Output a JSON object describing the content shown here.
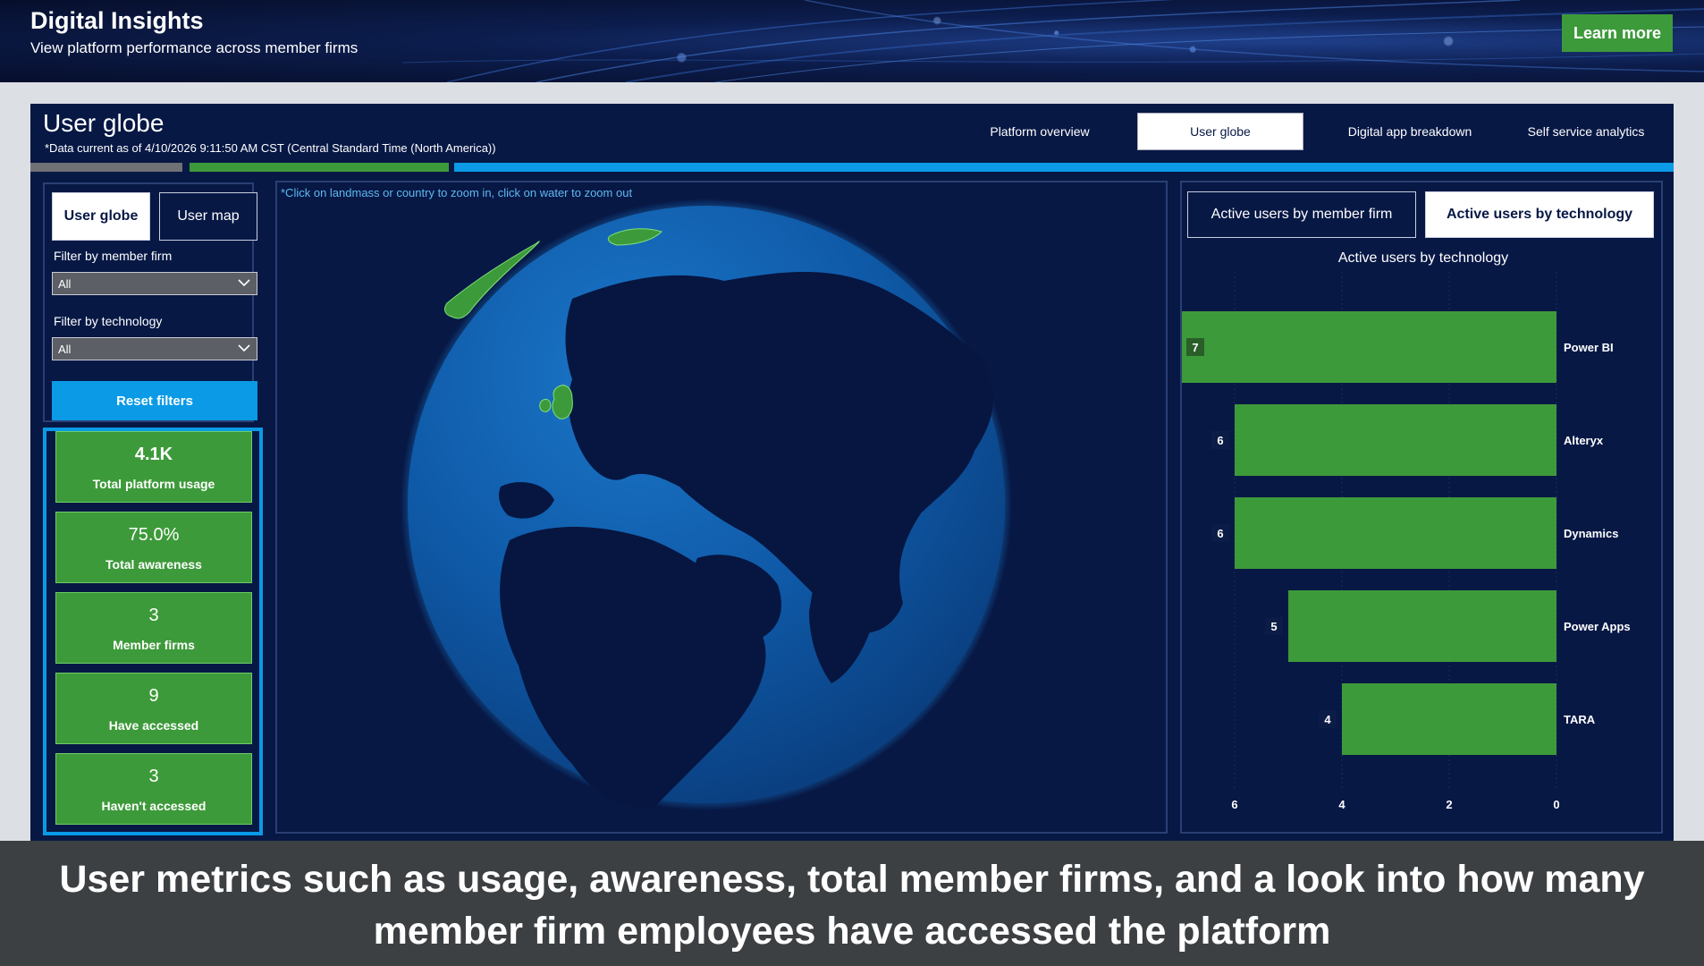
{
  "banner": {
    "title": "Digital Insights",
    "subtitle": "View platform performance across member firms",
    "learn_more": "Learn more"
  },
  "dashboard": {
    "title": "User globe",
    "data_note": "*Data current as of 4/10/2026 9:11:50 AM CST (Central Standard Time (North America))",
    "nav": [
      {
        "label": "Platform overview",
        "active": false
      },
      {
        "label": "User globe",
        "active": true
      },
      {
        "label": "Digital app breakdown",
        "active": false
      },
      {
        "label": "Self service analytics",
        "active": false
      }
    ],
    "colors": {
      "navy": "#071845",
      "green": "#3d9a3a",
      "blue": "#0a9ae6",
      "gray": "#6f7175"
    }
  },
  "left": {
    "tabs": [
      {
        "label": "User globe",
        "active": true
      },
      {
        "label": "User map",
        "active": false
      }
    ],
    "filter_member_label": "Filter by member firm",
    "filter_member_value": "All",
    "filter_tech_label": "Filter by technology",
    "filter_tech_value": "All",
    "reset": "Reset filters",
    "kpis": [
      {
        "value": "4.1K",
        "label": "Total platform usage"
      },
      {
        "value": "75.0%",
        "label": "Total awareness"
      },
      {
        "value": "3",
        "label": "Member firms"
      },
      {
        "value": "9",
        "label": "Have accessed"
      },
      {
        "value": "3",
        "label": "Haven't accessed"
      }
    ]
  },
  "globe": {
    "hint": "*Click on landmass or country to zoom in, click on water to zoom out",
    "highlighted": [
      "Greenland/Canada",
      "United Kingdom"
    ]
  },
  "chart_tabs": [
    {
      "label": "Active users by member firm",
      "active": false
    },
    {
      "label": "Active users by technology",
      "active": true
    }
  ],
  "chart_data": {
    "type": "bar",
    "orientation": "horizontal",
    "title": "Active users by technology",
    "categories": [
      "Power BI",
      "Alteryx",
      "Dynamics",
      "Power Apps",
      "TARA"
    ],
    "values": [
      7,
      6,
      6,
      5,
      4
    ],
    "xticks": [
      6,
      4,
      2,
      0
    ],
    "xlim": [
      0,
      7
    ],
    "reversed_axis": true,
    "bar_color": "#3d9a3a"
  },
  "caption": "User metrics such as usage, awareness, total member firms, and a look into how many member firm employees have accessed the platform"
}
